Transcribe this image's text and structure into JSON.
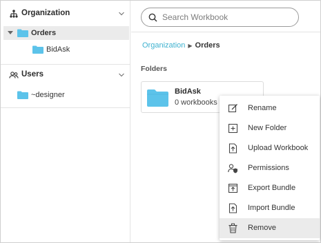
{
  "sidebar": {
    "organization": {
      "label": "Organization",
      "items": [
        {
          "label": "Orders"
        },
        {
          "label": "BidAsk"
        }
      ]
    },
    "users": {
      "label": "Users",
      "items": [
        {
          "label": "~designer"
        }
      ]
    }
  },
  "search": {
    "placeholder": "Search Workbook",
    "value": ""
  },
  "breadcrumb": {
    "root": "Organization",
    "current": "Orders"
  },
  "folders": {
    "title": "Folders",
    "cards": [
      {
        "name": "BidAsk",
        "count": "0 workbooks"
      }
    ]
  },
  "context_menu": {
    "items": [
      {
        "label": "Rename",
        "icon": "rename-icon"
      },
      {
        "label": "New Folder",
        "icon": "new-folder-icon"
      },
      {
        "label": "Upload Workbook",
        "icon": "upload-workbook-icon"
      },
      {
        "label": "Permissions",
        "icon": "permissions-icon"
      },
      {
        "label": "Export Bundle",
        "icon": "export-bundle-icon"
      },
      {
        "label": "Import Bundle",
        "icon": "import-bundle-icon"
      },
      {
        "label": "Remove",
        "icon": "trash-icon"
      }
    ]
  },
  "colors": {
    "accent": "#3db1cf",
    "folder": "#5cc3ea",
    "selected_bg": "#ebebeb"
  }
}
